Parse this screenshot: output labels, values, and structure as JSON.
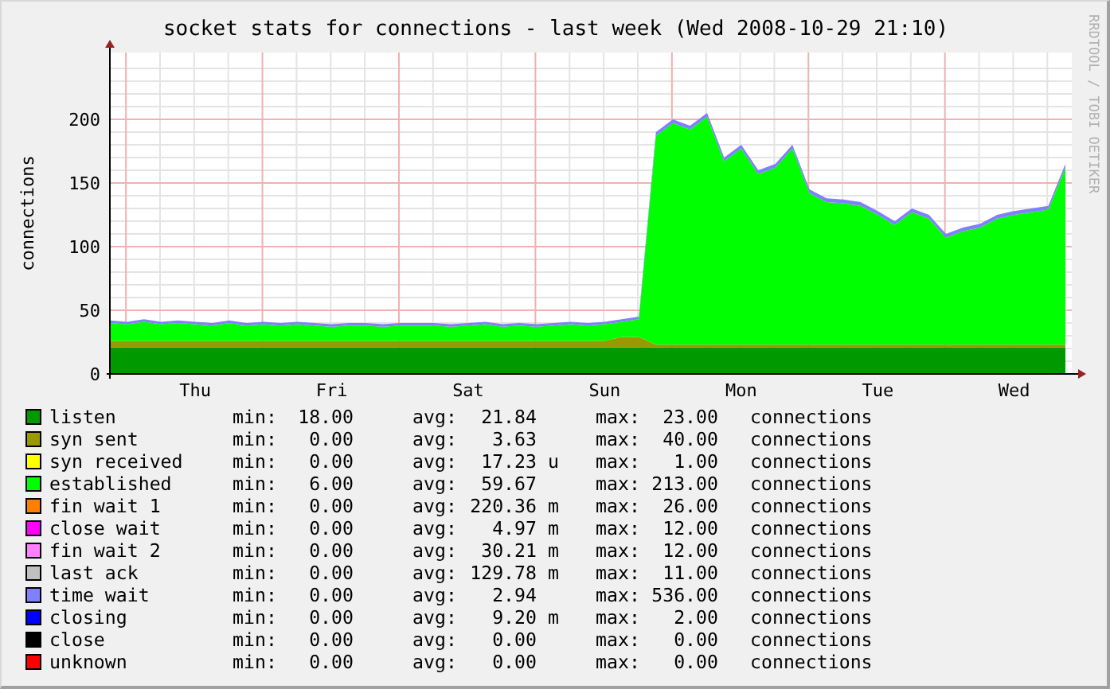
{
  "chart": {
    "credit": "RRDTOOL / TOBI OETIKER",
    "chart_data": {
      "type": "area",
      "title": "socket stats for connections - last week (Wed 2008-10-29 21:10)",
      "ylabel": "connections",
      "stacked": true,
      "categories": [
        null,
        null,
        null,
        null,
        null,
        "Thu",
        null,
        null,
        null,
        null,
        null,
        null,
        null,
        "Fri",
        null,
        null,
        null,
        null,
        null,
        null,
        null,
        "Sat",
        null,
        null,
        null,
        null,
        null,
        null,
        null,
        "Sun",
        null,
        null,
        null,
        null,
        null,
        null,
        null,
        "Mon",
        null,
        null,
        null,
        null,
        null,
        null,
        null,
        "Tue",
        null,
        null,
        null,
        null,
        null,
        null,
        null,
        "Wed",
        null,
        null,
        null
      ],
      "ylim": [
        0,
        252.5
      ],
      "grid": true,
      "yticks": [
        0,
        50,
        100,
        150,
        200
      ],
      "series": [
        {
          "color": "#009900",
          "values": [
            21,
            21,
            21,
            21,
            21,
            21,
            21,
            21,
            21,
            21,
            21,
            21,
            21,
            21,
            21,
            21,
            21,
            21,
            21,
            21,
            21,
            21,
            21,
            21,
            21,
            21,
            21,
            21,
            21,
            21,
            21,
            21,
            21,
            21,
            21,
            21,
            21,
            21,
            21,
            21,
            21,
            21,
            21,
            21,
            21,
            21,
            21,
            21,
            21,
            21,
            21,
            21,
            21,
            21,
            21,
            21,
            21
          ]
        },
        {
          "color": "#999900",
          "values": [
            5,
            5,
            5,
            5,
            5,
            5,
            5,
            5,
            5,
            5,
            5,
            5,
            5,
            5,
            5,
            5,
            5,
            5,
            5,
            5,
            5,
            5,
            5,
            5,
            5,
            5,
            5,
            5,
            5,
            5,
            8,
            8,
            2,
            2,
            2,
            2,
            2,
            2,
            2,
            2,
            2,
            2,
            2,
            2,
            2,
            2,
            2,
            2,
            2,
            2,
            2,
            2,
            2,
            2,
            2,
            2,
            2
          ]
        },
        {
          "color": "#00ff00",
          "values": [
            14,
            13,
            15,
            13,
            14,
            13,
            12,
            14,
            12,
            13,
            12,
            13,
            12,
            11,
            12,
            12,
            11,
            12,
            12,
            12,
            11,
            12,
            13,
            11,
            12,
            11,
            12,
            13,
            12,
            13,
            12,
            14,
            164,
            174,
            169,
            179,
            144,
            154,
            134,
            139,
            154,
            119,
            112,
            111,
            109,
            102,
            94,
            104,
            99,
            84,
            89,
            92,
            99,
            102,
            104,
            106,
            139
          ]
        },
        {
          "color": "#8080ff",
          "values": [
            2,
            2,
            2,
            2,
            2,
            2,
            2,
            2,
            2,
            2,
            2,
            2,
            2,
            2,
            2,
            2,
            2,
            2,
            2,
            2,
            2,
            2,
            2,
            2,
            2,
            2,
            2,
            2,
            2,
            2,
            2,
            2,
            3,
            3,
            3,
            3,
            3,
            3,
            3,
            3,
            3,
            3,
            3,
            3,
            3,
            3,
            3,
            3,
            3,
            3,
            3,
            3,
            3,
            3,
            3,
            3,
            3
          ]
        }
      ]
    }
  },
  "legend": [
    {
      "name": "listen",
      "color": "#009900",
      "min_label": "min:",
      "min": "18.00",
      "avg_label": "avg:",
      "avg": "21.84",
      "max_label": "max:",
      "max": "23.00",
      "unit": "connections"
    },
    {
      "name": "syn sent",
      "color": "#999900",
      "min_label": "min:",
      "min": "0.00",
      "avg_label": "avg:",
      "avg": "3.63",
      "max_label": "max:",
      "max": "40.00",
      "unit": "connections"
    },
    {
      "name": "syn received",
      "color": "#ffff00",
      "min_label": "min:",
      "min": "0.00",
      "avg_label": "avg:",
      "avg": "17.23",
      "avg_prefix": "u",
      "max_label": "max:",
      "max": "1.00",
      "unit": "connections"
    },
    {
      "name": "established",
      "color": "#00ff00",
      "min_label": "min:",
      "min": "6.00",
      "avg_label": "avg:",
      "avg": "59.67",
      "max_label": "max:",
      "max": "213.00",
      "unit": "connections"
    },
    {
      "name": "fin wait 1",
      "color": "#ff8000",
      "min_label": "min:",
      "min": "0.00",
      "avg_label": "avg:",
      "avg": "220.36",
      "avg_prefix": "m",
      "max_label": "max:",
      "max": "26.00",
      "unit": "connections"
    },
    {
      "name": "close wait",
      "color": "#ff00ff",
      "min_label": "min:",
      "min": "0.00",
      "avg_label": "avg:",
      "avg": "4.97",
      "avg_prefix": "m",
      "max_label": "max:",
      "max": "12.00",
      "unit": "connections"
    },
    {
      "name": "fin wait 2",
      "color": "#ff80ff",
      "min_label": "min:",
      "min": "0.00",
      "avg_label": "avg:",
      "avg": "30.21",
      "avg_prefix": "m",
      "max_label": "max:",
      "max": "12.00",
      "unit": "connections"
    },
    {
      "name": "last ack",
      "color": "#c0c0c0",
      "min_label": "min:",
      "min": "0.00",
      "avg_label": "avg:",
      "avg": "129.78",
      "avg_prefix": "m",
      "max_label": "max:",
      "max": "11.00",
      "unit": "connections"
    },
    {
      "name": "time wait",
      "color": "#8080ff",
      "min_label": "min:",
      "min": "0.00",
      "avg_label": "avg:",
      "avg": "2.94",
      "max_label": "max:",
      "max": "536.00",
      "unit": "connections"
    },
    {
      "name": "closing",
      "color": "#0000ff",
      "min_label": "min:",
      "min": "0.00",
      "avg_label": "avg:",
      "avg": "9.20",
      "avg_prefix": "m",
      "max_label": "max:",
      "max": "2.00",
      "unit": "connections"
    },
    {
      "name": "close",
      "color": "#000000",
      "min_label": "min:",
      "min": "0.00",
      "avg_label": "avg:",
      "avg": "0.00",
      "max_label": "max:",
      "max": "0.00",
      "unit": "connections"
    },
    {
      "name": "unknown",
      "color": "#ff0000",
      "min_label": "min:",
      "min": "0.00",
      "avg_label": "avg:",
      "avg": "0.00",
      "max_label": "max:",
      "max": "0.00",
      "unit": "connections"
    }
  ]
}
